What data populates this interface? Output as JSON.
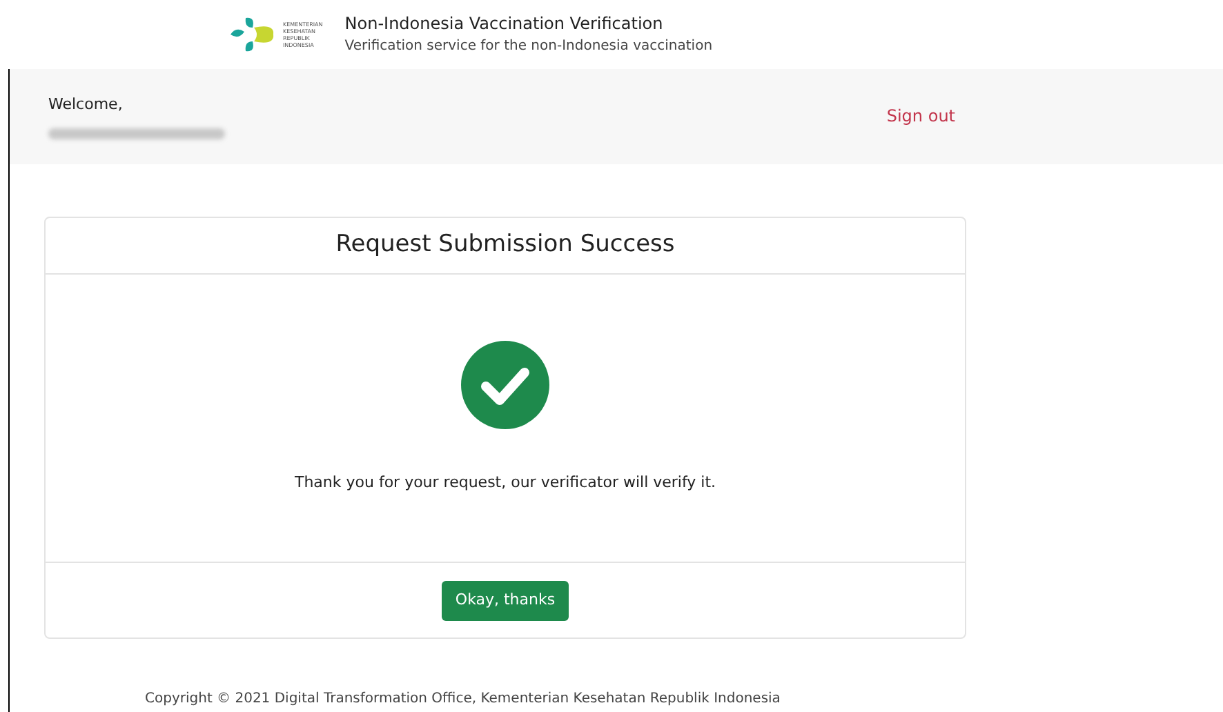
{
  "header": {
    "logo_text": [
      "KEMENTERIAN",
      "KESEHATAN",
      "REPUBLIK",
      "INDONESIA"
    ],
    "title": "Non-Indonesia Vaccination Verification",
    "subtitle": "Verification service for the non-Indonesia vaccination"
  },
  "user_bar": {
    "greeting": "Welcome,",
    "sign_out": "Sign out"
  },
  "card": {
    "title": "Request Submission Success",
    "message": "Thank you for your request, our verificator will verify it.",
    "button": "Okay, thanks"
  },
  "footer": "Copyright © 2021 Digital Transformation Office, Kementerian Kesehatan Republik Indonesia"
}
